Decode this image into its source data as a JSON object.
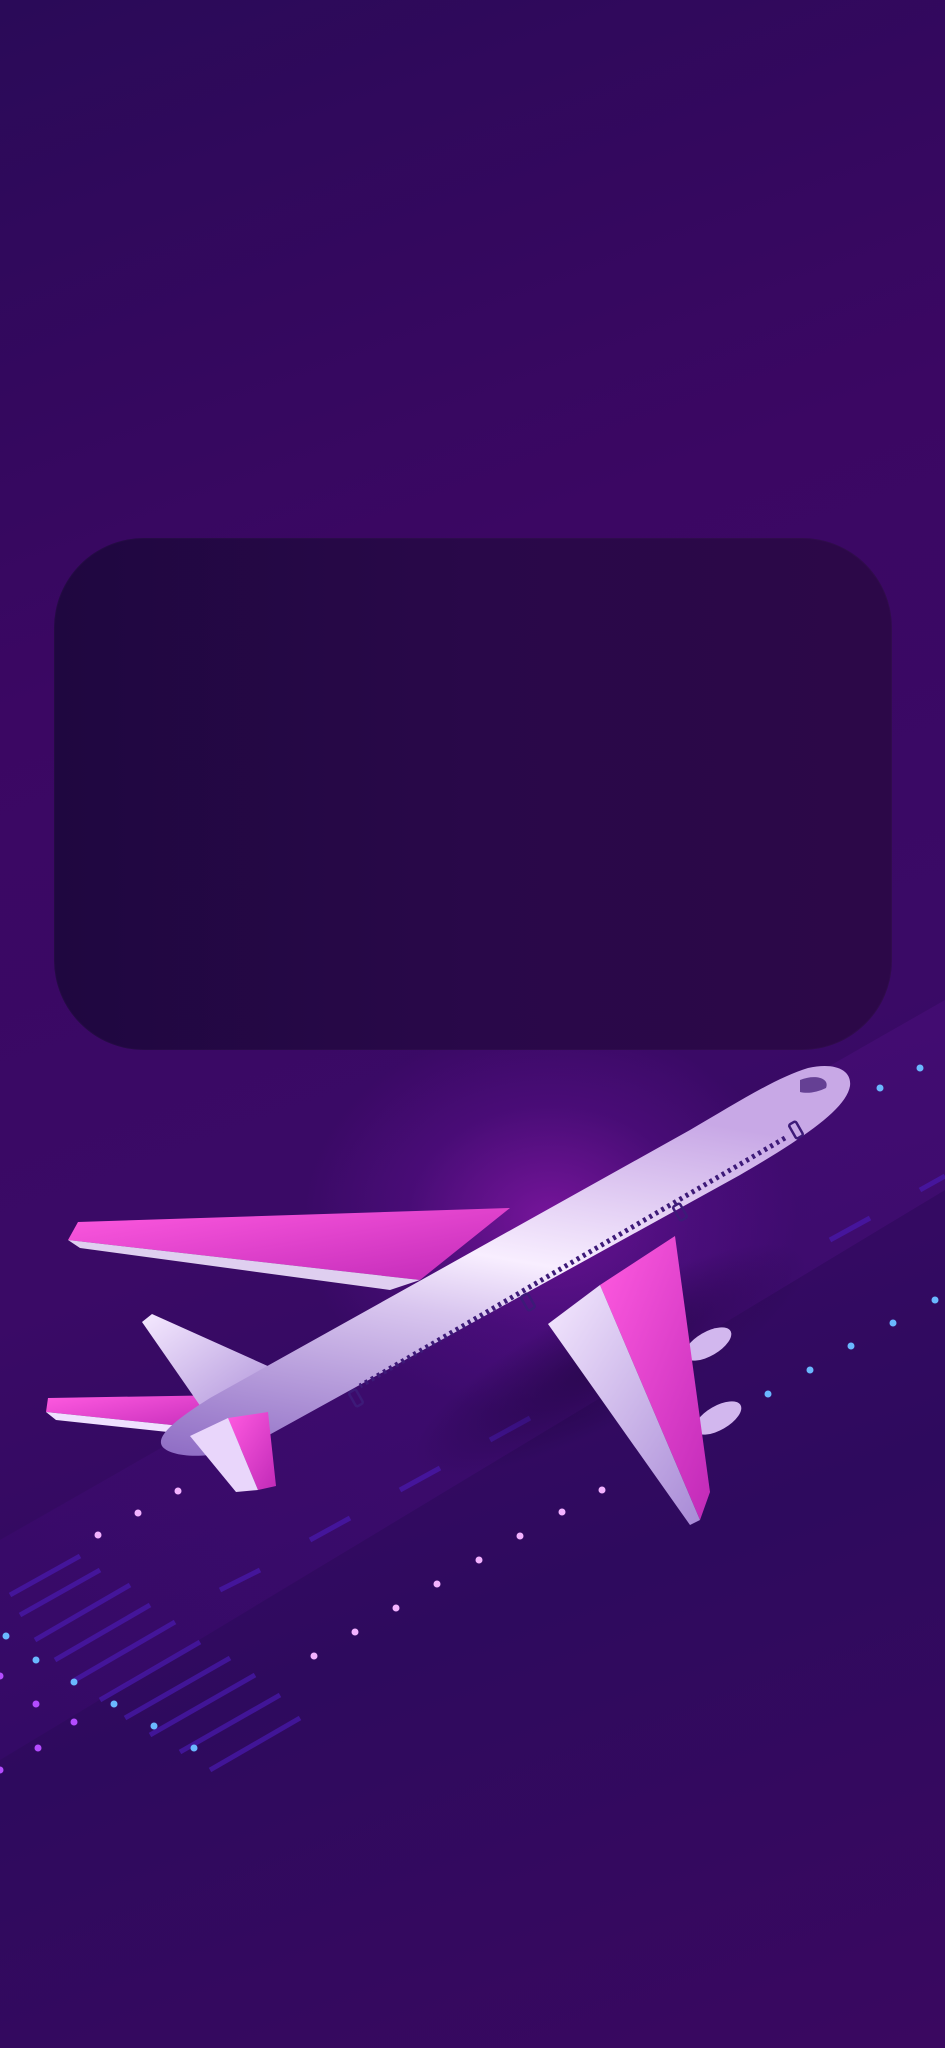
{
  "screen": {
    "name": "splash-screen",
    "background_colors": [
      "#2a0a58",
      "#3b0763",
      "#2e0a5e"
    ]
  },
  "card": {
    "title": "",
    "color": "#240744"
  },
  "illustration": {
    "subject": "airplane-icon",
    "body_color": "#e6d4f2",
    "accent_color": "#e23fd0",
    "runway_light_colors": [
      "#5fb4ff",
      "#f0a0ff",
      "#b040ff"
    ]
  }
}
